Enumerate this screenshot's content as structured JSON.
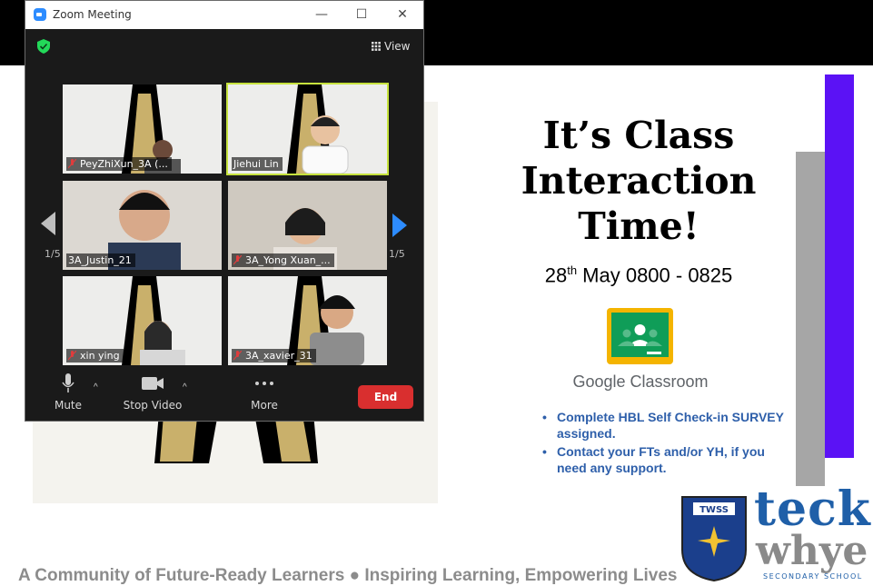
{
  "window": {
    "title": "Zoom Meeting",
    "minimize": "—",
    "maximize": "☐",
    "close": "✕",
    "view_label": "View"
  },
  "participants": [
    {
      "name": "PeyZhiXun_3A (...",
      "muted": true
    },
    {
      "name": "Jiehui Lin",
      "muted": false,
      "active_speaker": true
    },
    {
      "name": "3A_Justin_21",
      "muted": false
    },
    {
      "name": "3A_Yong Xuan_...",
      "muted": true
    },
    {
      "name": "xin ying",
      "muted": true
    },
    {
      "name": "3A_xavier_31",
      "muted": true
    }
  ],
  "pagination": {
    "left": "1/5",
    "right": "1/5"
  },
  "toolbar": {
    "mute_label": "Mute",
    "video_label": "Stop Video",
    "more_label": "More",
    "end_label": "End"
  },
  "slide": {
    "title_lines": [
      "It’s Class",
      "Interaction",
      "Time!"
    ],
    "date_day": "28",
    "date_suffix": "th",
    "date_rest": " May 0800 - 0825",
    "classroom_label": "Google Classroom",
    "bullets": [
      "Complete HBL Self Check-in SURVEY assigned.",
      "Contact your FTs and/or YH, if you need any support."
    ],
    "crest_text": "TWSS",
    "brand_line1": "teck",
    "brand_line2": "whye",
    "brand_line3": "SECONDARY SCHOOL",
    "footer": "A Community of Future-Ready Learners ●  Inspiring Learning, Empowering Lives"
  },
  "colors": {
    "accent_purple": "#5b12f5",
    "accent_grey": "#a6a6a6",
    "zoom_blue": "#2d8cff",
    "end_red": "#d92f2f",
    "active_border": "#c6e23d",
    "bullet_blue": "#2e5faa"
  }
}
